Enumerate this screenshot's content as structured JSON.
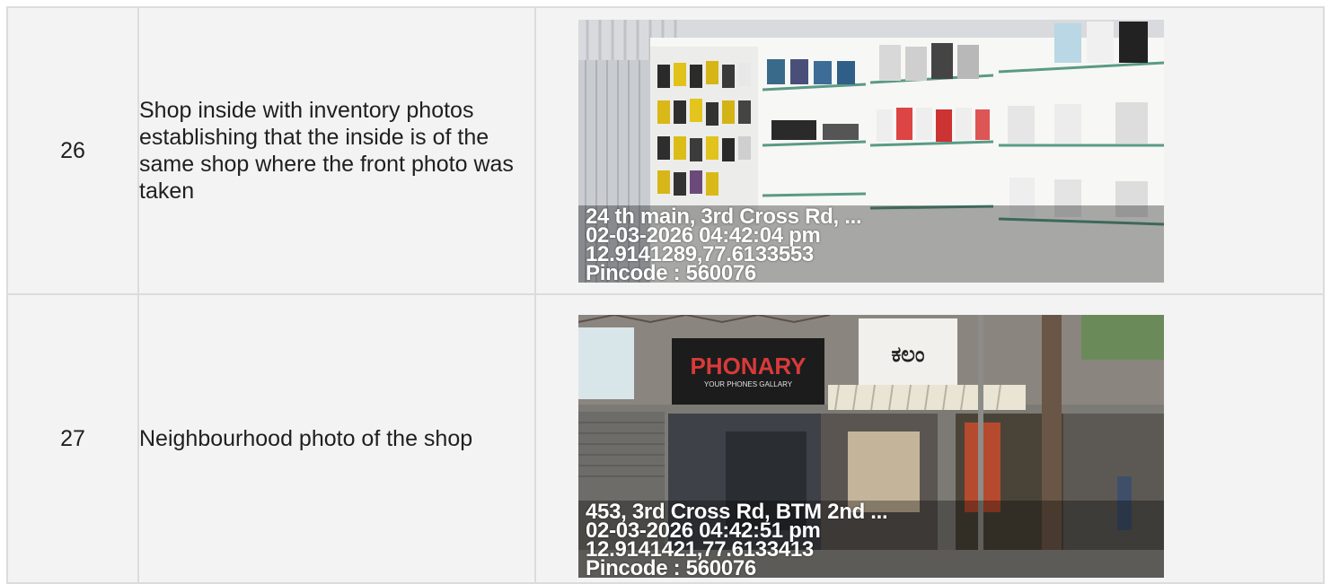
{
  "rows": [
    {
      "number": "26",
      "description": "Shop inside with inventory photos establishing that the inside is of the same shop where the front photo was taken",
      "photo": {
        "subject": "shop interior with phone accessories on shelves",
        "stamp": {
          "address": "24 th main, 3rd Cross Rd, ...",
          "datetime": "02-03-2026 04:42:04 pm",
          "coords": "12.9141289,77.6133553",
          "pincode": "Pincode : 560076"
        }
      }
    },
    {
      "number": "27",
      "description": "Neighbourhood photo of the shop",
      "photo": {
        "subject": "street view of shop front and neighbouring stores",
        "signs": {
          "shop_name": "PHONARY",
          "shop_tagline": "YOUR PHONES GALLARY",
          "neighbour_sign": "ಕಲಂ"
        },
        "stamp": {
          "address": "453, 3rd Cross Rd, BTM 2nd ...",
          "datetime": "02-03-2026 04:42:51 pm",
          "coords": "12.9141421,77.6133413",
          "pincode": "Pincode : 560076"
        }
      }
    }
  ]
}
